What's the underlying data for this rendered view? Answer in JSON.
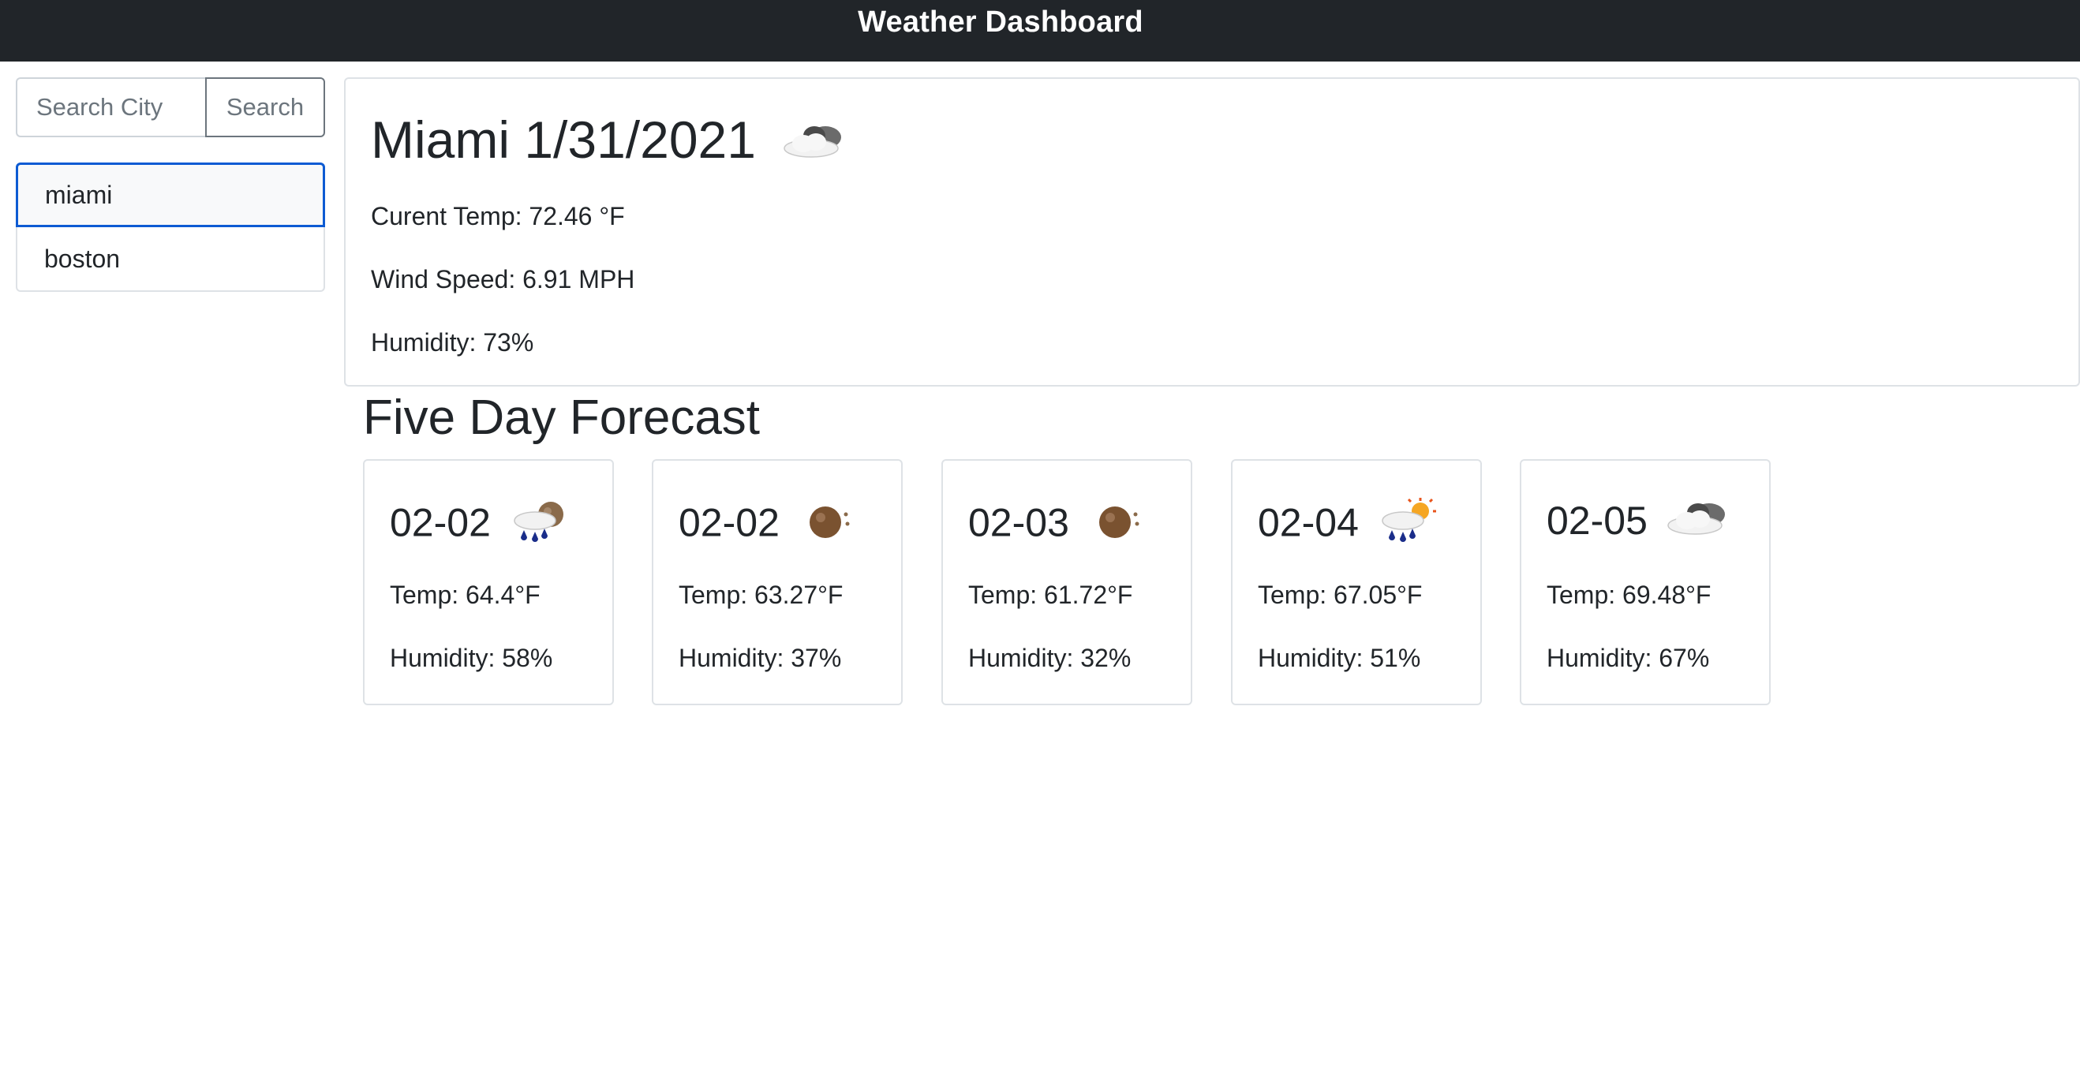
{
  "header": {
    "title": "Weather Dashboard"
  },
  "search": {
    "placeholder": "Search City",
    "button_label": "Search"
  },
  "history": [
    {
      "label": "miami"
    },
    {
      "label": "boston"
    }
  ],
  "current": {
    "city_date": "Miami 1/31/2021",
    "icon": "cloudy-icon",
    "temp": "Curent Temp: 72.46 °F",
    "wind": "Wind Speed: 6.91 MPH",
    "humidity": "Humidity: 73%"
  },
  "forecast": {
    "heading": "Five Day Forecast",
    "days": [
      {
        "date": "02-02",
        "icon": "rain-night-icon",
        "temp": "Temp: 64.4°F",
        "humidity": "Humidity: 58%"
      },
      {
        "date": "02-02",
        "icon": "clear-night-icon",
        "temp": "Temp: 63.27°F",
        "humidity": "Humidity: 37%"
      },
      {
        "date": "02-03",
        "icon": "clear-night-icon",
        "temp": "Temp: 61.72°F",
        "humidity": "Humidity: 32%"
      },
      {
        "date": "02-04",
        "icon": "rain-day-icon",
        "temp": "Temp: 67.05°F",
        "humidity": "Humidity: 51%"
      },
      {
        "date": "02-05",
        "icon": "cloudy-icon",
        "temp": "Temp: 69.48°F",
        "humidity": "Humidity: 67%"
      }
    ]
  },
  "colors": {
    "navbar": "#212529",
    "accent": "#0d5bd3",
    "border": "#dee2e6"
  }
}
